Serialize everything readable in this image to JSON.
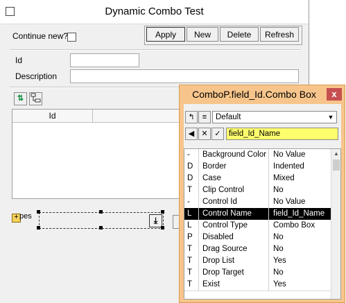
{
  "main_window": {
    "title": "Dynamic Combo Test",
    "continue_new_label": "Continue new?",
    "buttons": {
      "apply": "Apply",
      "new": "New",
      "delete": "Delete",
      "refresh": "Refresh"
    },
    "fields": {
      "id_label": "Id",
      "description_label": "Description",
      "id_value": "",
      "description_value": ""
    },
    "table": {
      "columns": [
        "Id",
        ""
      ]
    },
    "combo_label": "pes"
  },
  "property_window": {
    "title": "ComboP.field_Id.Combo Box",
    "close_label": "x",
    "preset_select": "Default",
    "name_value": "field_Id_Name",
    "rows": [
      {
        "type": "-",
        "name": "Background Color",
        "value": "No Value"
      },
      {
        "type": "D",
        "name": "Border",
        "value": "Indented"
      },
      {
        "type": "D",
        "name": "Case",
        "value": "Mixed"
      },
      {
        "type": "T",
        "name": "Clip Control",
        "value": "No"
      },
      {
        "type": "-",
        "name": "Control Id",
        "value": "No Value"
      },
      {
        "type": "L",
        "name": "Control Name",
        "value": "field_Id_Name",
        "selected": true
      },
      {
        "type": "L",
        "name": "Control Type",
        "value": "Combo Box"
      },
      {
        "type": "P",
        "name": "Disabled",
        "value": "No"
      },
      {
        "type": "T",
        "name": "Drag Source",
        "value": "No"
      },
      {
        "type": "T",
        "name": "Drop List",
        "value": "Yes"
      },
      {
        "type": "T",
        "name": "Drop Target",
        "value": "No"
      },
      {
        "type": "T",
        "name": "Exist",
        "value": "Yes"
      }
    ]
  }
}
